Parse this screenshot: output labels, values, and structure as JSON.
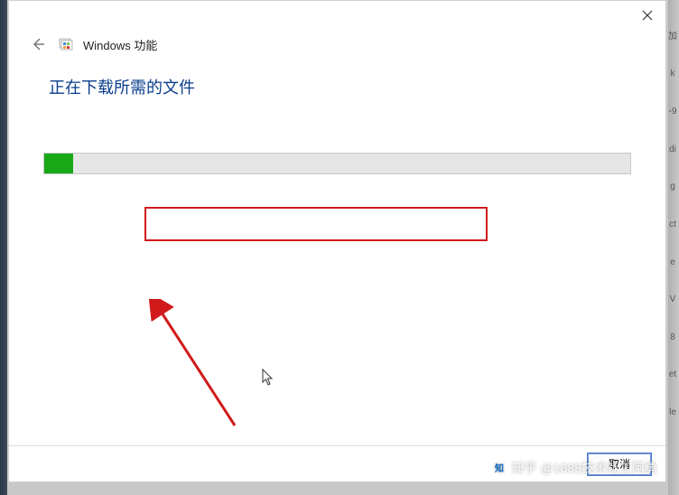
{
  "dialog": {
    "title": "Windows 功能",
    "heading": "正在下载所需的文件",
    "progress_percent": 5,
    "cancel_label": "取消"
  },
  "annotation": {
    "red_box_present": true,
    "arrow_present": true
  },
  "watermark": {
    "text": "知乎 @1688技术社工阿勇"
  },
  "background_fragments": [
    "加",
    "k",
    "-9",
    "di",
    "g",
    "ct",
    "e",
    "V",
    "8",
    "et",
    "le"
  ]
}
